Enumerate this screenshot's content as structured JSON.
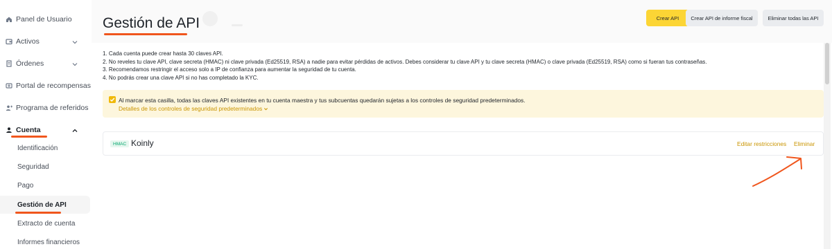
{
  "sidebar": {
    "items": [
      {
        "label": "Panel de Usuario",
        "icon": "home-icon",
        "has_chevron": false
      },
      {
        "label": "Activos",
        "icon": "wallet-icon",
        "has_chevron": true
      },
      {
        "label": "Órdenes",
        "icon": "orders-icon",
        "has_chevron": true
      },
      {
        "label": "Portal de recompensas",
        "icon": "rewards-icon",
        "has_chevron": false
      },
      {
        "label": "Programa de referidos",
        "icon": "add-user-icon",
        "has_chevron": false
      },
      {
        "label": "Cuenta",
        "icon": "user-icon",
        "has_chevron": true,
        "expanded": true
      }
    ],
    "sub_items": [
      {
        "label": "Identificación"
      },
      {
        "label": "Seguridad"
      },
      {
        "label": "Pago"
      },
      {
        "label": "Gestión de API",
        "selected": true
      },
      {
        "label": "Extracto de cuenta"
      },
      {
        "label": "Informes financieros"
      }
    ]
  },
  "header": {
    "title": "Gestión de API",
    "buttons": {
      "create": "Crear API",
      "create_tax": "Crear API de informe fiscal",
      "delete_all": "Eliminar todas las API"
    }
  },
  "notes": [
    "1. Cada cuenta puede crear hasta 30 claves API.",
    "2. No reveles tu clave API, clave secreta (HMAC) ni clave privada (Ed25519, RSA) a nadie para evitar pérdidas de activos. Debes considerar tu clave API y tu clave secreta (HMAC) o clave privada (Ed25519, RSA) como si fueran tus contraseñas.",
    "3. Recomendamos restringir el acceso solo a IP de confianza para aumentar la seguridad de tu cuenta.",
    "4. No podrás crear una clave API si no has completado la KYC."
  ],
  "security_banner": {
    "checked": true,
    "text": "Al marcar esta casilla, todas las claves API existentes en tu cuenta maestra y tus subcuentas quedarán sujetas a los controles de seguridad predeterminados.",
    "link": "Detalles de los controles de seguridad predeterminados"
  },
  "api_keys": [
    {
      "type": "HMAC",
      "name": "Koinly",
      "edit_label": "Editar restricciones",
      "delete_label": "Eliminar"
    }
  ],
  "colors": {
    "brand_yellow": "#fcd535",
    "link_gold": "#c99400",
    "annotation_orange": "#f0561d",
    "banner_bg": "#fdf6dd",
    "hmac_green": "#03a66d"
  }
}
